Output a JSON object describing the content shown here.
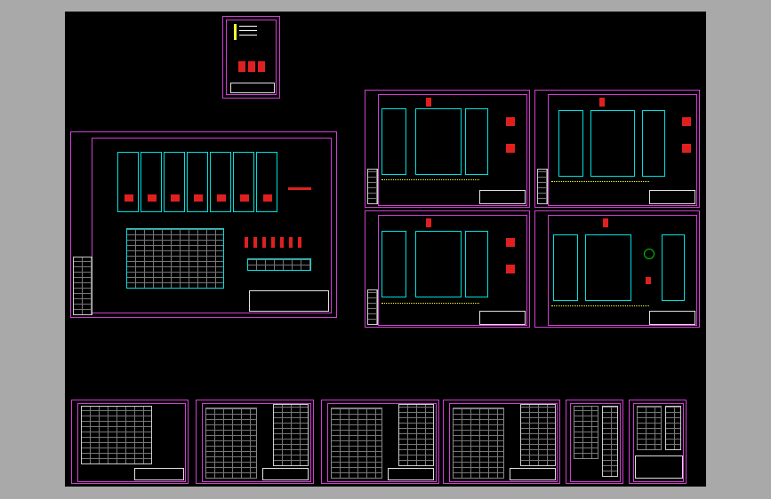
{
  "viewer": {
    "background_color": "#a9a9a9",
    "canvas_color": "#000000",
    "frame_color": "#d040d0"
  },
  "sheets": {
    "overview": {
      "title": "",
      "panel_count": 7,
      "note": ""
    },
    "elevation_sheets": [
      {
        "label": "",
        "note": ""
      },
      {
        "label": "",
        "note": ""
      },
      {
        "label": "",
        "note": ""
      },
      {
        "label": "",
        "note": ""
      }
    ],
    "schematic_sheets": [
      {
        "label": ""
      },
      {
        "label": ""
      },
      {
        "label": ""
      },
      {
        "label": ""
      },
      {
        "label": ""
      },
      {
        "label": ""
      }
    ]
  }
}
